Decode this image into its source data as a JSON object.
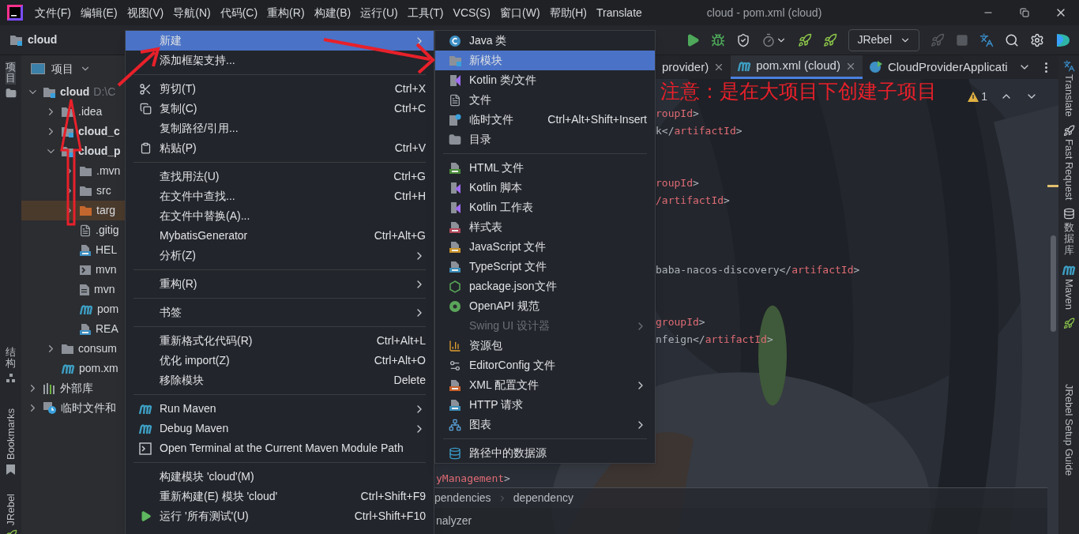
{
  "window": {
    "title": "cloud - pom.xml (cloud)"
  },
  "menu_bar": [
    "文件(F)",
    "编辑(E)",
    "视图(V)",
    "导航(N)",
    "代码(C)",
    "重构(R)",
    "构建(B)",
    "运行(U)",
    "工具(T)",
    "VCS(S)",
    "窗口(W)",
    "帮助(H)",
    "Translate"
  ],
  "toolbar": {
    "project": "cloud",
    "run_config": "JRebel"
  },
  "left_strip": [
    {
      "label": "项目",
      "kind": "cjk",
      "selected": true
    },
    {
      "label": "结构",
      "kind": "cjk",
      "selected": false
    },
    {
      "label": "Bookmarks",
      "kind": "latin",
      "selected": false
    },
    {
      "label": "JRebel",
      "kind": "latin",
      "selected": false
    }
  ],
  "project_panel": {
    "title": "项目",
    "tree": [
      {
        "label": "cloud",
        "path": "D:\\C",
        "kind": "module",
        "expanded": true,
        "children": [
          {
            "label": ".idea",
            "kind": "folder",
            "expanded": false
          },
          {
            "label": "cloud_c",
            "kind": "module",
            "expanded": false
          },
          {
            "label": "cloud_p",
            "kind": "module",
            "expanded": true,
            "children": [
              {
                "label": ".mvn",
                "kind": "folder",
                "expanded": false
              },
              {
                "label": "src",
                "kind": "folder",
                "expanded": false
              },
              {
                "label": "targ",
                "kind": "excluded-folder",
                "expanded": false
              },
              {
                "label": ".gitig",
                "kind": "ignore-file"
              },
              {
                "label": "HEL",
                "kind": "markdown"
              },
              {
                "label": "mvn",
                "kind": "script"
              },
              {
                "label": "mvn",
                "kind": "text"
              },
              {
                "label": "pom",
                "kind": "maven"
              },
              {
                "label": "REA",
                "kind": "markdown"
              }
            ]
          },
          {
            "label": "consum",
            "kind": "folder",
            "expanded": false
          },
          {
            "label": "pom.xm",
            "kind": "maven"
          }
        ]
      },
      {
        "label": "外部库",
        "kind": "library",
        "expanded": false
      },
      {
        "label": "临时文件和",
        "kind": "scratch",
        "expanded": false
      }
    ]
  },
  "tabs": [
    {
      "label": "provider)",
      "selected": false,
      "close_button": true
    },
    {
      "label": "pom.xml (cloud)",
      "selected": true,
      "close_button": true
    },
    {
      "label": "CloudProviderApplicati",
      "selected": false,
      "close_button": false
    }
  ],
  "inspections": {
    "warnings": "1"
  },
  "code_lines": [
    "roupId>",
    "k</artifactId>",
    "roupId>",
    "/artifactId>",
    "baba-nacos-discovery</artifactId>",
    "groupId>",
    "nfeign</artifactId>",
    "yManagement>"
  ],
  "breadcrumbs": [
    "pendencies",
    "dependency"
  ],
  "status_bar": {
    "tool": "nalyzer"
  },
  "right_strip": [
    {
      "label": "Translate",
      "kind": "latin"
    },
    {
      "label": "Fast Request",
      "kind": "latin"
    },
    {
      "label": "数据库",
      "kind": "cjk"
    },
    {
      "label": "Maven",
      "kind": "latin"
    },
    {
      "label": "JRebel Setup Guide",
      "kind": "latin"
    }
  ],
  "context_menu": [
    {
      "kind": "item",
      "label": "新建",
      "submenu": true,
      "selected": true
    },
    {
      "kind": "item",
      "label": "添加框架支持...",
      "submenu": false,
      "selected": false
    },
    {
      "kind": "separator"
    },
    {
      "kind": "item",
      "label": "剪切(T)",
      "shortcut": "Ctrl+X",
      "submenu": false,
      "selected": false
    },
    {
      "kind": "item",
      "label": "复制(C)",
      "shortcut": "Ctrl+C",
      "submenu": false,
      "selected": false
    },
    {
      "kind": "item",
      "label": "复制路径/引用...",
      "submenu": false,
      "selected": false
    },
    {
      "kind": "item",
      "label": "粘贴(P)",
      "shortcut": "Ctrl+V",
      "submenu": false,
      "selected": false
    },
    {
      "kind": "separator"
    },
    {
      "kind": "item",
      "label": "查找用法(U)",
      "shortcut": "Ctrl+G",
      "submenu": false,
      "selected": false
    },
    {
      "kind": "item",
      "label": "在文件中查找...",
      "shortcut": "Ctrl+H",
      "submenu": false,
      "selected": false
    },
    {
      "kind": "item",
      "label": "在文件中替换(A)...",
      "submenu": false,
      "selected": false
    },
    {
      "kind": "item",
      "label": "MybatisGenerator",
      "shortcut": "Ctrl+Alt+G",
      "submenu": false,
      "selected": false
    },
    {
      "kind": "item",
      "label": "分析(Z)",
      "submenu": true,
      "selected": false
    },
    {
      "kind": "separator"
    },
    {
      "kind": "item",
      "label": "重构(R)",
      "submenu": true,
      "selected": false
    },
    {
      "kind": "separator"
    },
    {
      "kind": "item",
      "label": "书签",
      "submenu": true,
      "selected": false
    },
    {
      "kind": "separator"
    },
    {
      "kind": "item",
      "label": "重新格式化代码(R)",
      "shortcut": "Ctrl+Alt+L",
      "submenu": false,
      "selected": false
    },
    {
      "kind": "item",
      "label": "优化 import(Z)",
      "shortcut": "Ctrl+Alt+O",
      "submenu": false,
      "selected": false
    },
    {
      "kind": "item",
      "label": "移除模块",
      "shortcut": "Delete",
      "submenu": false,
      "selected": false
    },
    {
      "kind": "separator"
    },
    {
      "kind": "item",
      "label": "Run Maven",
      "submenu": true,
      "selected": false
    },
    {
      "kind": "item",
      "label": "Debug Maven",
      "submenu": true,
      "selected": false
    },
    {
      "kind": "item",
      "label": "Open Terminal at the Current Maven Module Path",
      "submenu": false,
      "selected": false
    },
    {
      "kind": "separator"
    },
    {
      "kind": "item",
      "label": "构建模块 'cloud'(M)",
      "submenu": false,
      "selected": false
    },
    {
      "kind": "item",
      "label": "重新构建(E) 模块 'cloud'",
      "shortcut": "Ctrl+Shift+F9",
      "submenu": false,
      "selected": false
    },
    {
      "kind": "item",
      "label": "运行 '所有测试'(U)",
      "shortcut": "Ctrl+Shift+F10",
      "submenu": false,
      "selected": false
    }
  ],
  "new_submenu": [
    {
      "kind": "item",
      "label": "Java 类",
      "submenu": false,
      "selected": false,
      "disabled": false
    },
    {
      "kind": "item",
      "label": "新模块",
      "submenu": false,
      "selected": true,
      "disabled": false
    },
    {
      "kind": "item",
      "label": "Kotlin 类/文件",
      "submenu": false,
      "selected": false,
      "disabled": false
    },
    {
      "kind": "item",
      "label": "文件",
      "submenu": false,
      "selected": false,
      "disabled": false
    },
    {
      "kind": "item",
      "label": "临时文件",
      "shortcut": "Ctrl+Alt+Shift+Insert",
      "submenu": false,
      "selected": false,
      "disabled": false
    },
    {
      "kind": "item",
      "label": "目录",
      "submenu": false,
      "selected": false,
      "disabled": false
    },
    {
      "kind": "separator"
    },
    {
      "kind": "item",
      "label": "HTML 文件",
      "submenu": false,
      "selected": false,
      "disabled": false
    },
    {
      "kind": "item",
      "label": "Kotlin 脚本",
      "submenu": false,
      "selected": false,
      "disabled": false
    },
    {
      "kind": "item",
      "label": "Kotlin 工作表",
      "submenu": false,
      "selected": false,
      "disabled": false
    },
    {
      "kind": "item",
      "label": "样式表",
      "submenu": false,
      "selected": false,
      "disabled": false
    },
    {
      "kind": "item",
      "label": "JavaScript 文件",
      "submenu": false,
      "selected": false,
      "disabled": false
    },
    {
      "kind": "item",
      "label": "TypeScript 文件",
      "submenu": false,
      "selected": false,
      "disabled": false
    },
    {
      "kind": "item",
      "label": "package.json文件",
      "submenu": false,
      "selected": false,
      "disabled": false
    },
    {
      "kind": "item",
      "label": "OpenAPI 规范",
      "submenu": false,
      "selected": false,
      "disabled": false
    },
    {
      "kind": "item",
      "label": "Swing UI 设计器",
      "submenu": true,
      "selected": false,
      "disabled": true
    },
    {
      "kind": "item",
      "label": "资源包",
      "submenu": false,
      "selected": false,
      "disabled": false
    },
    {
      "kind": "item",
      "label": "EditorConfig 文件",
      "submenu": false,
      "selected": false,
      "disabled": false
    },
    {
      "kind": "item",
      "label": "XML 配置文件",
      "submenu": true,
      "selected": false,
      "disabled": false
    },
    {
      "kind": "item",
      "label": "HTTP 请求",
      "submenu": false,
      "selected": false,
      "disabled": false
    },
    {
      "kind": "item",
      "label": "图表",
      "submenu": true,
      "selected": false,
      "disabled": false
    },
    {
      "kind": "separator"
    },
    {
      "kind": "item",
      "label": "路径中的数据源",
      "submenu": false,
      "selected": false,
      "disabled": false
    }
  ],
  "annotation": {
    "text": "注意：是在大项目下创建子项目"
  }
}
